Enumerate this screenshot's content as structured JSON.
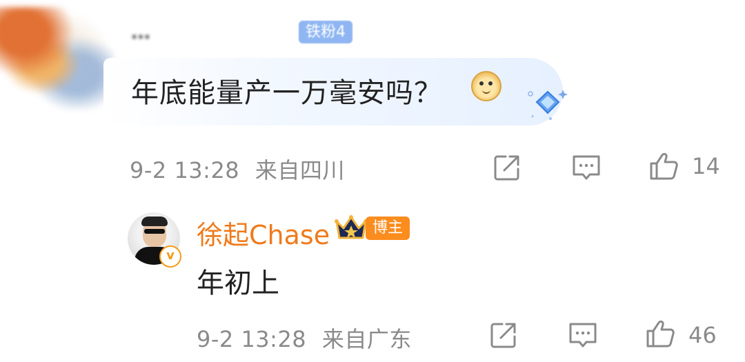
{
  "comment": {
    "username": "…",
    "fan_badge": "铁粉4",
    "text": "年底能量产一万毫安吗？",
    "meta": {
      "date_time": "9-2 13:28",
      "location": "来自四川"
    },
    "actions": {
      "like_count": "14"
    }
  },
  "reply": {
    "username": "徐起Chase",
    "badge": "博主",
    "text": "年初上",
    "meta": {
      "date_time": "9-2 13:28",
      "location": "来自广东"
    },
    "actions": {
      "like_count": "46"
    }
  },
  "icons": {
    "share": "share-icon",
    "comment": "comment-icon",
    "like": "like-icon",
    "verified": "verified-v-icon",
    "crown": "crown-icon",
    "emoji": "doge-emoji-icon",
    "diamond": "diamond-decoration-icon"
  },
  "colors": {
    "meta_gray": "#8a8a8a",
    "reply_name_orange": "#f07a1a",
    "blogger_badge_orange": "#fb8c1e",
    "fan_badge_blue": "#8fb6f2",
    "bubble_blue": "#e6f0ff"
  }
}
